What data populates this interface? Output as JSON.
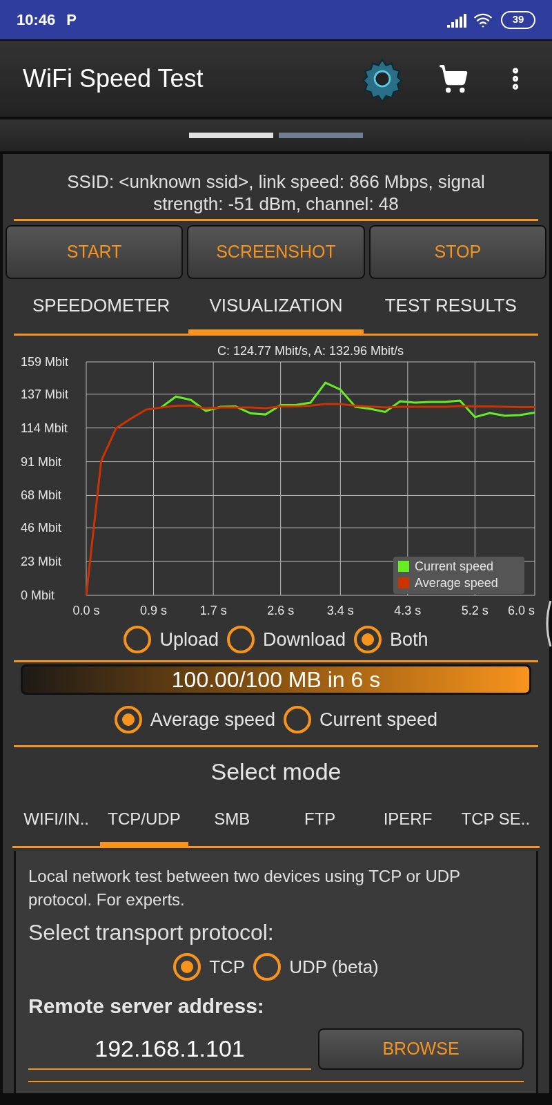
{
  "status_bar": {
    "time": "10:46",
    "notification": "P",
    "battery": "39"
  },
  "app_bar": {
    "title": "WiFi Speed Test"
  },
  "pager": [
    {
      "selected": true
    },
    {
      "selected": false
    }
  ],
  "info": "SSID: <unknown ssid>, link speed: 866 Mbps, signal strength: -51 dBm, channel: 48",
  "actions": [
    "START",
    "SCREENSHOT",
    "STOP"
  ],
  "tabs": [
    {
      "label": "SPEEDOMETER",
      "selected": false
    },
    {
      "label": "VISUALIZATION",
      "selected": true
    },
    {
      "label": "TEST RESULTS",
      "selected": false
    }
  ],
  "chart": {
    "chart_data": {
      "type": "line",
      "title": "C: 124.77 Mbit/s, A: 132.96 Mbit/s",
      "x": [
        0,
        0.2,
        0.4,
        0.6,
        0.8,
        1.0,
        1.2,
        1.4,
        1.6,
        1.8,
        2.0,
        2.2,
        2.4,
        2.6,
        2.8,
        3.0,
        3.2,
        3.4,
        3.6,
        3.8,
        4.0,
        4.2,
        4.4,
        4.6,
        4.8,
        5.0,
        5.2,
        5.4,
        5.6,
        5.8,
        6.0
      ],
      "series": [
        {
          "name": "Current speed",
          "color": "#66ee22",
          "values": [
            null,
            null,
            null,
            null,
            null,
            127.9,
            135.4,
            133.1,
            125.6,
            128.4,
            128.6,
            123.9,
            123.2,
            129.6,
            129.6,
            131.2,
            144.8,
            140.1,
            128.4,
            127.0,
            124.9,
            132.2,
            131.2,
            131.7,
            131.7,
            132.6,
            121.4,
            124.2,
            122.3,
            122.8,
            124.4
          ]
        },
        {
          "name": "Average speed",
          "color": "#cc3300",
          "values": [
            0,
            91.5,
            113.8,
            120.4,
            126.5,
            127.9,
            129.1,
            129.3,
            127.2,
            127.9,
            127.9,
            127.9,
            127.5,
            128.6,
            128.6,
            129.3,
            130.3,
            130.3,
            129.1,
            128.6,
            127.9,
            128.4,
            128.4,
            128.4,
            128.4,
            128.9,
            128.6,
            128.6,
            128.4,
            128.2,
            128.2
          ]
        }
      ],
      "xlim": [
        0,
        6
      ],
      "ylim": [
        0,
        159
      ],
      "grid": true,
      "legend": "lower right",
      "xticks": [
        {
          "value": 0,
          "label": "0.0 s"
        },
        {
          "value": 0.9,
          "label": "0.9 s"
        },
        {
          "value": 1.7,
          "label": "1.7 s"
        },
        {
          "value": 2.6,
          "label": "2.6 s"
        },
        {
          "value": 3.4,
          "label": "3.4 s"
        },
        {
          "value": 4.3,
          "label": "4.3 s"
        },
        {
          "value": 5.2,
          "label": "5.2 s"
        },
        {
          "value": 6,
          "label": "6.0 s"
        }
      ],
      "yticks": [
        {
          "value": 0,
          "label": "0 Mbit"
        },
        {
          "value": 23,
          "label": "23 Mbit"
        },
        {
          "value": 46,
          "label": "46 Mbit"
        },
        {
          "value": 68,
          "label": "68 Mbit"
        },
        {
          "value": 91,
          "label": "91 Mbit"
        },
        {
          "value": 114,
          "label": "114 Mbit"
        },
        {
          "value": 137,
          "label": "137 Mbit"
        },
        {
          "value": 159,
          "label": "159 Mbit"
        }
      ]
    }
  },
  "direction": [
    {
      "label": "Upload",
      "selected": false
    },
    {
      "label": "Download",
      "selected": false
    },
    {
      "label": "Both",
      "selected": true
    }
  ],
  "progress": {
    "text": "100.00/100 MB in 6 s",
    "level": 1.0
  },
  "speed_display": [
    {
      "label": "Average speed",
      "selected": true
    },
    {
      "label": "Current speed",
      "selected": false
    }
  ],
  "mode_title": "Select mode",
  "mode_tabs": [
    {
      "label": "WIFI/IN..",
      "selected": false
    },
    {
      "label": "TCP/UDP",
      "selected": true
    },
    {
      "label": "SMB",
      "selected": false
    },
    {
      "label": "FTP",
      "selected": false
    },
    {
      "label": "IPERF",
      "selected": false
    },
    {
      "label": "TCP SE..",
      "selected": false
    }
  ],
  "mode_panel": {
    "description": "Local network test between two devices using TCP or UDP protocol. For experts.",
    "protocol_label": "Select transport protocol:",
    "protocols": [
      {
        "label": "TCP",
        "selected": true
      },
      {
        "label": "UDP (beta)",
        "selected": false
      }
    ],
    "address_label": "Remote server address:",
    "address_value": "192.168.1.101",
    "browse": "BROWSE"
  }
}
